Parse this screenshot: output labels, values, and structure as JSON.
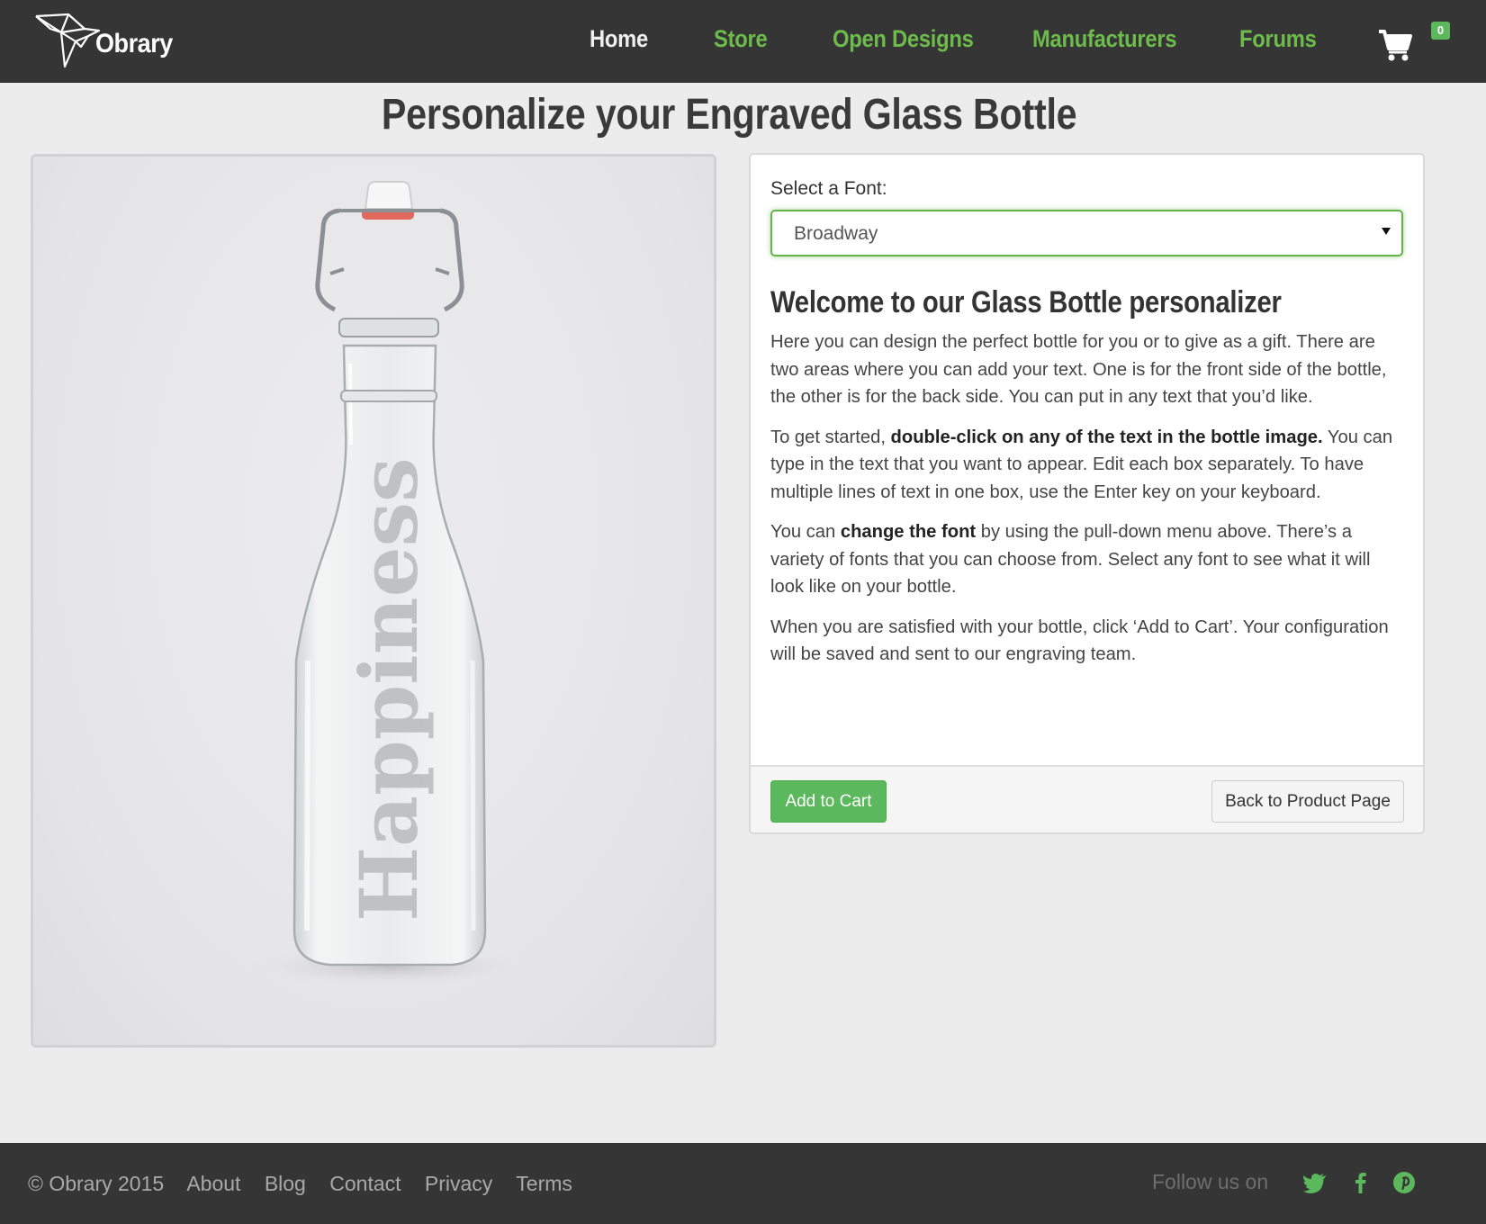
{
  "brand": {
    "name": "Obrary"
  },
  "nav": {
    "items": [
      {
        "label": "Home",
        "active": true
      },
      {
        "label": "Store"
      },
      {
        "label": "Open Designs"
      },
      {
        "label": "Manufacturers"
      },
      {
        "label": "Forums"
      }
    ],
    "cart_icon": "shopping-cart-icon",
    "cart_count": "0"
  },
  "page": {
    "title": "Personalize your Engraved Glass Bottle"
  },
  "preview": {
    "engraved_text": "Happiness",
    "image": "glass-bottle-photo"
  },
  "config": {
    "font_label": "Select a Font:",
    "font_selected": "Broadway",
    "heading": "Welcome to our Glass Bottle personalizer",
    "p1": "Here you can design the perfect bottle for you or to give as a gift. There are two areas where you can add your text. One is for the front side of the bottle, the other is for the back side. You can put in any text that you’d like.",
    "p2_pre": "To get started, ",
    "p2_bold": "double-click on any of the text in the bottle image.",
    "p2_post": " You can type in the text that you want to appear. Edit each box separately. To have multiple lines of text in one box, use the Enter key on your keyboard.",
    "p3_pre": "You can ",
    "p3_bold": "change the font",
    "p3_post": " by using the pull-down menu above. There’s a variety of fonts that you can choose from. Select any font to see what it will look like on your bottle.",
    "p4": "When you are satisfied with your bottle, click ‘Add to Cart’. Your configuration will be saved and sent to our engraving team.",
    "add_to_cart": "Add to Cart",
    "back": "Back to Product Page"
  },
  "footer": {
    "copyright": "© Obrary 2015",
    "links": [
      "About",
      "Blog",
      "Contact",
      "Privacy",
      "Terms"
    ],
    "follow": "Follow us on",
    "social_icons": [
      "twitter-icon",
      "facebook-icon",
      "pinterest-icon"
    ]
  },
  "colors": {
    "accent": "#5cb85c",
    "nav_bg": "#353535",
    "page_bg": "#ececec"
  }
}
